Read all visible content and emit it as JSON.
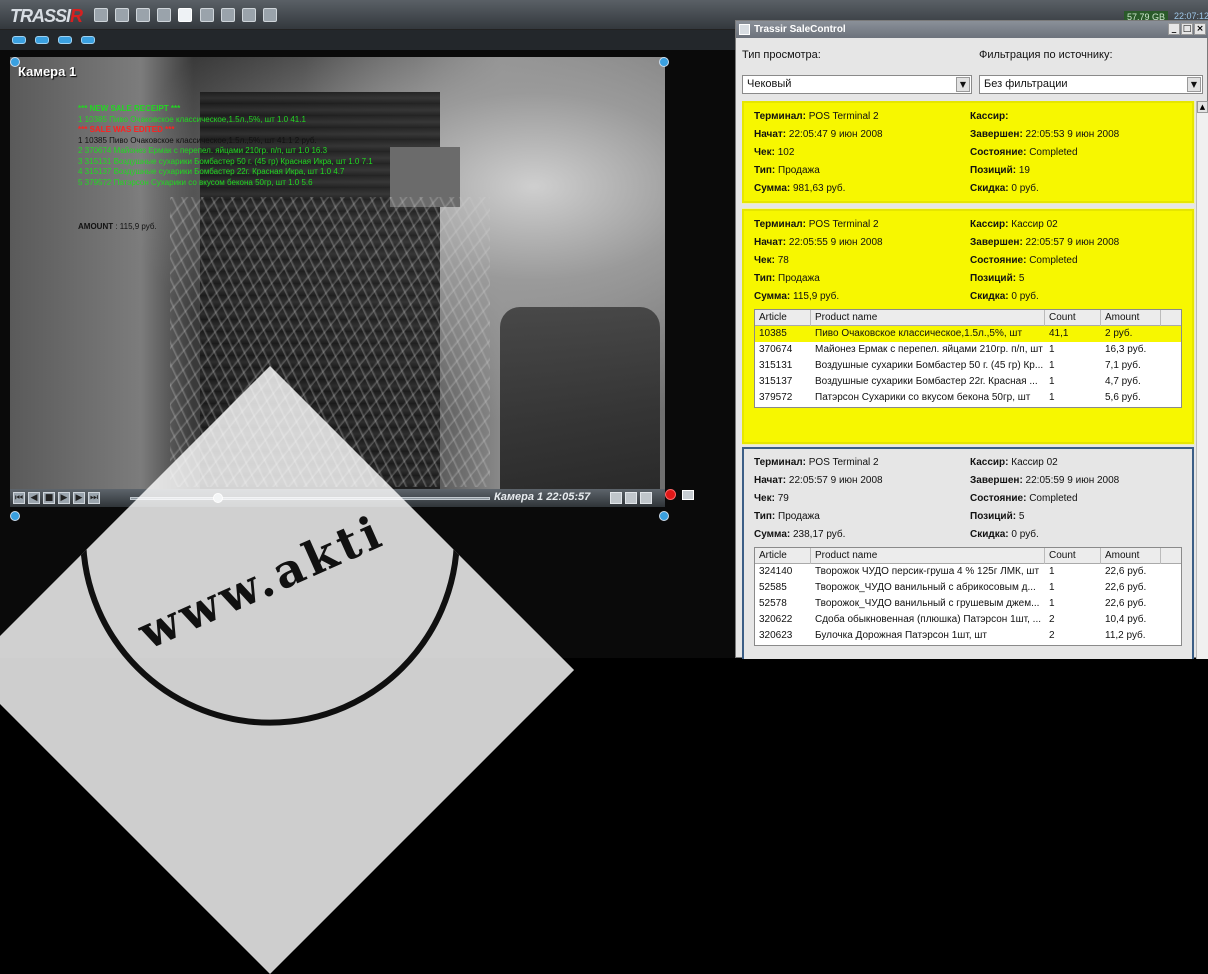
{
  "app": {
    "logo_main": "TRASSI",
    "logo_accent": "R"
  },
  "layouts": [
    "layout-1",
    "layout-2",
    "layout-3",
    "layout-4"
  ],
  "camera": {
    "label": "Камера 1",
    "timestamp_label": "Камера 1 22:05:57",
    "overlay": {
      "new_receipt": "*** NEW SALE RECEIPT ***",
      "line_initial": "1 10385 Пиво Очаковское классическое,1.5л.,5%, шт 1.0 41.1",
      "edited": "*** SALE WAS EDITED ***",
      "lines": [
        "1 10385 Пиво Очаковское классическое,1.5л.,5%, шт 41.1 2 руб.",
        "2 370674 Майонез Ермак с перепел. яйцами 210гр. п/п, шт 1.0 16.3",
        "3 315131 Воздушные сухарики Бомбастер 50 г. (45 гр) Красная Икра, шт 1.0 7.1",
        "4 315137 Воздушные сухарики Бомбастер 22г. Красная Икра, шт 1.0 4.7",
        "5 379572 Патэрсон Сухарики со вкусом бекона 50гр, шт 1.0 5.6"
      ],
      "amount_label": "AMOUNT",
      "amount_value": " : 115,9 руб."
    }
  },
  "tray": {
    "disk": "57.79 GB",
    "clock": "22:07:12"
  },
  "watermark": {
    "text": "www.akti"
  },
  "salecontrol": {
    "title": "Trassir SaleControl",
    "view_label": "Тип просмотра:",
    "filter_label": "Фильтрация по источнику:",
    "view_value": "Чековый",
    "filter_value": "Без фильтрации",
    "field_labels": {
      "terminal": "Терминал:",
      "started": "Начат:",
      "check": "Чек:",
      "type": "Тип:",
      "sum": "Сумма:",
      "cashier": "Кассир:",
      "finished": "Завершен:",
      "state": "Состояние:",
      "positions": "Позиций:",
      "discount": "Скидка:"
    },
    "table_headers": {
      "article": "Article",
      "product": "Product name",
      "count": "Count",
      "amount": "Amount"
    },
    "receipts": [
      {
        "terminal": " POS Terminal 2",
        "cashier": "",
        "started": " 22:05:47 9 июн 2008",
        "finished": " 22:05:53 9 июн 2008",
        "check": " 102",
        "state": " Completed",
        "type": " Продажа",
        "positions": " 19",
        "sum": " 981,63 руб.",
        "discount": " 0 руб."
      },
      {
        "terminal": " POS Terminal 2",
        "cashier": " Кассир 02",
        "started": " 22:05:55 9 июн 2008",
        "finished": " 22:05:57 9 июн 2008",
        "check": " 78",
        "state": " Completed",
        "type": " Продажа",
        "positions": " 5",
        "sum": " 115,9 руб.",
        "discount": " 0 руб.",
        "items": [
          {
            "article": "10385",
            "product": "Пиво Очаковское классическое,1.5л.,5%, шт",
            "count": "41,1",
            "amount": "2 руб."
          },
          {
            "article": "370674",
            "product": "Майонез Ермак с перепел. яйцами 210гр. п/п, шт",
            "count": "1",
            "amount": "16,3 руб."
          },
          {
            "article": "315131",
            "product": "Воздушные сухарики Бомбастер 50 г. (45 гр) Кр...",
            "count": "1",
            "amount": "7,1 руб."
          },
          {
            "article": "315137",
            "product": "Воздушные сухарики Бомбастер 22г. Красная ...",
            "count": "1",
            "amount": "4,7 руб."
          },
          {
            "article": "379572",
            "product": "Патэрсон Сухарики со вкусом бекона 50гр, шт",
            "count": "1",
            "amount": "5,6 руб."
          }
        ]
      },
      {
        "terminal": " POS Terminal 2",
        "cashier": " Кассир 02",
        "started": " 22:05:57 9 июн 2008",
        "finished": " 22:05:59 9 июн 2008",
        "check": " 79",
        "state": " Completed",
        "type": " Продажа",
        "positions": " 5",
        "sum": " 238,17 руб.",
        "discount": " 0 руб.",
        "items": [
          {
            "article": "324140",
            "product": "Творожок ЧУДО персик-груша 4 % 125г ЛМК, шт",
            "count": "1",
            "amount": "22,6 руб."
          },
          {
            "article": "52585",
            "product": "Творожок_ЧУДО ванильный с абрикосовым д...",
            "count": "1",
            "amount": "22,6 руб."
          },
          {
            "article": "52578",
            "product": "Творожок_ЧУДО ванильный с грушевым джем...",
            "count": "1",
            "amount": "22,6 руб."
          },
          {
            "article": "320622",
            "product": "Сдоба обыкновенная (плюшка) Патэрсон 1шт, ...",
            "count": "2",
            "amount": "10,4 руб."
          },
          {
            "article": "320623",
            "product": "Булочка Дорожная Патэрсон 1шт, шт",
            "count": "2",
            "amount": "11,2 руб."
          }
        ]
      }
    ]
  }
}
